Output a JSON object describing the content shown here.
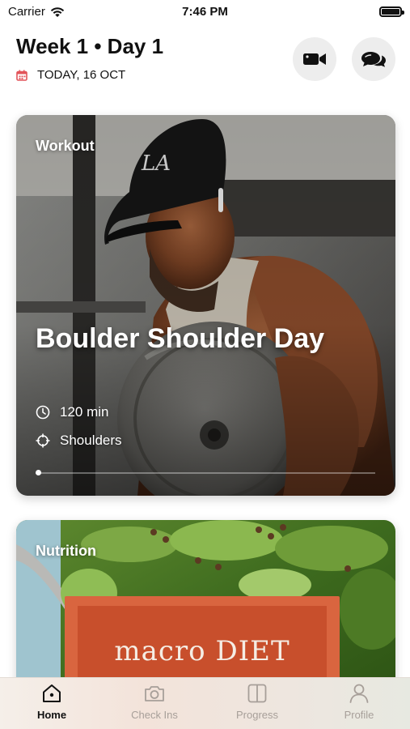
{
  "status_bar": {
    "carrier": "Carrier",
    "time": "7:46 PM"
  },
  "header": {
    "title": "Week 1 • Day 1",
    "date": "TODAY, 16 OCT"
  },
  "workout_card": {
    "tag": "Workout",
    "title": "Boulder Shoulder Day",
    "duration": "120 min",
    "focus": "Shoulders"
  },
  "nutrition_card": {
    "tag": "Nutrition",
    "image_title": "macro DIET"
  },
  "tab_bar": {
    "home": "Home",
    "check_ins": "Check Ins",
    "progress": "Progress",
    "profile": "Profile"
  },
  "colors": {
    "accent": "#d9653f",
    "calendar_icon": "#e2545a",
    "inactive_tab": "#a79f99"
  }
}
